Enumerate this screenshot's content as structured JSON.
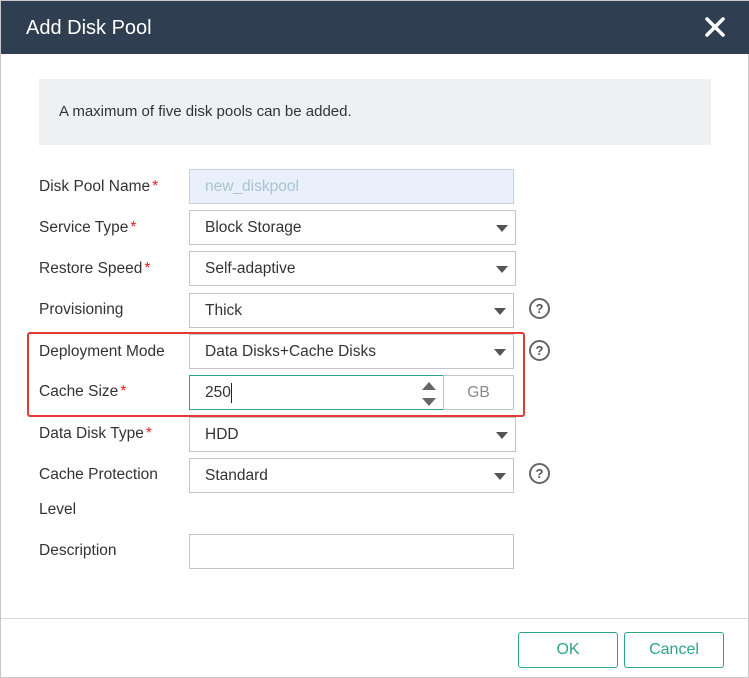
{
  "dialog": {
    "title": "Add Disk Pool",
    "close_icon": "close-icon"
  },
  "notice": "A maximum of five disk pools can be added.",
  "form": {
    "disk_pool_name": {
      "label": "Disk Pool Name",
      "required": "*",
      "placeholder": "new_diskpool",
      "value": ""
    },
    "service_type": {
      "label": "Service Type",
      "required": "*",
      "value": "Block Storage"
    },
    "restore_speed": {
      "label": "Restore Speed",
      "required": "*",
      "value": "Self-adaptive"
    },
    "provisioning": {
      "label": "Provisioning",
      "value": "Thick",
      "help_icon": "help-icon"
    },
    "deployment_mode": {
      "label": "Deployment Mode",
      "value": "Data Disks+Cache Disks",
      "help_icon": "help-icon"
    },
    "cache_size": {
      "label": "Cache Size",
      "required": "*",
      "value": "250",
      "unit": "GB"
    },
    "data_disk_type": {
      "label": "Data Disk Type",
      "required": "*",
      "value": "HDD"
    },
    "cache_protection_level": {
      "label_line1": "Cache Protection",
      "label_line2": "Level",
      "value": "Standard",
      "help_icon": "help-icon"
    },
    "description": {
      "label": "Description",
      "value": ""
    }
  },
  "buttons": {
    "ok": "OK",
    "cancel": "Cancel"
  },
  "help_glyph": "?",
  "colors": {
    "titlebar": "#2f3e50",
    "accent": "#2ca58d",
    "highlight": "#e53935",
    "required": "#e02020"
  }
}
